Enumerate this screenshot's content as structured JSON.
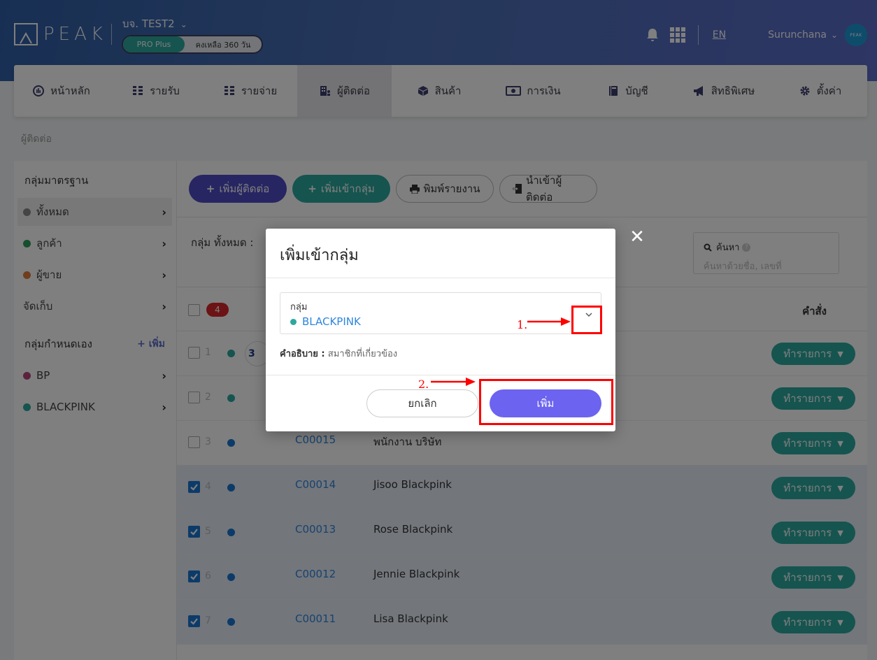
{
  "header": {
    "logo_text": "PEAK",
    "company": "บจ. TEST2",
    "plan": "PRO Plus",
    "remaining": "คงเหลือ 360 วัน",
    "lang": "EN",
    "user": "Surunchana",
    "avatar_text": "PEAK"
  },
  "nav": {
    "items": [
      {
        "label": "หน้าหลัก",
        "icon": "dashboard-icon"
      },
      {
        "label": "รายรับ",
        "icon": "income-icon"
      },
      {
        "label": "รายจ่าย",
        "icon": "expense-icon"
      },
      {
        "label": "ผู้ติดต่อ",
        "icon": "contacts-icon"
      },
      {
        "label": "สินค้า",
        "icon": "product-box-icon"
      },
      {
        "label": "การเงิน",
        "icon": "money-icon"
      },
      {
        "label": "บัญชี",
        "icon": "accounting-book-icon"
      },
      {
        "label": "สิทธิพิเศษ",
        "icon": "megaphone-icon"
      },
      {
        "label": "ตั้งค่า",
        "icon": "gear-icon"
      }
    ]
  },
  "breadcrumb": "ผู้ติดต่อ",
  "sidebar": {
    "standard_title": "กลุ่มมาตรฐาน",
    "standard": [
      {
        "label": "ทั้งหมด",
        "color": "#8a8a8a"
      },
      {
        "label": "ลูกค้า",
        "color": "#2e9d5a"
      },
      {
        "label": "ผู้ขาย",
        "color": "#e07b3a"
      },
      {
        "label": "จัดเก็บ",
        "color": ""
      }
    ],
    "custom_title": "กลุ่มกำหนดเอง",
    "add_label": "+ เพิ่ม",
    "custom": [
      {
        "label": "BP",
        "color": "#b8457a"
      },
      {
        "label": "BLACKPINK",
        "color": "#2ca89f"
      }
    ]
  },
  "toolbar": {
    "add_contact": "เพิ่มผู้ติดต่อ",
    "add_to_group": "เพิ่มเข้ากลุ่ม",
    "print_report": "พิมพ์รายงาน",
    "import_contacts": "นำเข้าผู้ติดต่อ"
  },
  "filter": {
    "group_label": "กลุ่ม ทั้งหมด :",
    "search_title": "ค้นหา",
    "search_placeholder": "ค้นหาด้วยชื่อ, เลขที่"
  },
  "table": {
    "selected_count": "4",
    "command_header": "คำสั่ง",
    "action_label": "ทำรายการ",
    "rows": [
      {
        "num": "1",
        "code": "",
        "name": "",
        "color": "#2ca89f",
        "checked": false
      },
      {
        "num": "2",
        "code": "",
        "name": "",
        "color": "#2ca89f",
        "checked": false
      },
      {
        "num": "3",
        "code": "C00015",
        "name": "พนักงาน บริษัท",
        "color": "#1976d2",
        "checked": false
      },
      {
        "num": "4",
        "code": "C00014",
        "name": "Jisoo Blackpink",
        "color": "#1976d2",
        "checked": true
      },
      {
        "num": "5",
        "code": "C00013",
        "name": "Rose Blackpink",
        "color": "#1976d2",
        "checked": true
      },
      {
        "num": "6",
        "code": "C00012",
        "name": "Jennie Blackpink",
        "color": "#1976d2",
        "checked": true
      },
      {
        "num": "7",
        "code": "C00011",
        "name": "Lisa Blackpink",
        "color": "#1976d2",
        "checked": true
      }
    ]
  },
  "modal": {
    "title": "เพิ่มเข้ากลุ่ม",
    "select_label": "กลุ่ม",
    "select_value": "BLACKPINK",
    "select_color": "#2ca89f",
    "desc_label": "คำอธิบาย :",
    "desc_value": "สมาชิกที่เกี่ยวข้อง",
    "cancel": "ยกเลิก",
    "add": "เพิ่ม"
  },
  "annotations": {
    "step1": "1.",
    "step2": "2."
  }
}
